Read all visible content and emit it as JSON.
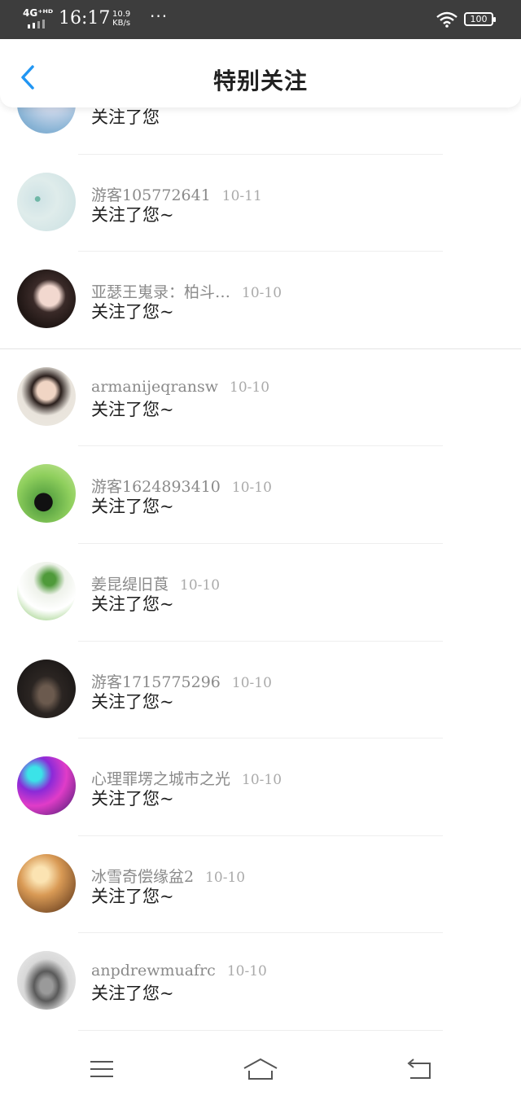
{
  "status_bar": {
    "network": "4G⁺ᴴᴰ",
    "time": "16:17",
    "speed_value": "10.9",
    "speed_unit": "KB/s",
    "more": "···",
    "battery": "100"
  },
  "header": {
    "title": "特别关注",
    "back_icon": "chevron-left-icon",
    "accent_color": "#2196F3"
  },
  "items": [
    {
      "name": "",
      "date": "",
      "message": "关注了您",
      "avatar": "girl-sky-photo"
    },
    {
      "name": "游客105772641",
      "date": "10-11",
      "message": "关注了您~",
      "avatar": "flower-sky-photo"
    },
    {
      "name": "亚瑟王嵬录：柏斗…",
      "date": "10-10",
      "message": "关注了您~",
      "avatar": "girl-portrait-photo"
    },
    {
      "name": "armanijeqransw",
      "date": "10-10",
      "message": "关注了您~",
      "avatar": "woman-portrait-photo"
    },
    {
      "name": "游客1624893410",
      "date": "10-10",
      "message": "关注了您~",
      "avatar": "kumamon-photo"
    },
    {
      "name": "姜昆缇旧莨",
      "date": "10-10",
      "message": "关注了您~",
      "avatar": "green-sprout-photo"
    },
    {
      "name": "游客1715775296",
      "date": "10-10",
      "message": "关注了您~",
      "avatar": "vintage-car-photo"
    },
    {
      "name": "心理罪塄之城市之光",
      "date": "10-10",
      "message": "关注了您~",
      "avatar": "bokeh-lights-photo"
    },
    {
      "name": "冰雪奇偿缘盆2",
      "date": "10-10",
      "message": "关注了您~",
      "avatar": "sunset-girl-photo"
    },
    {
      "name": "anpdrewmuafrc",
      "date": "10-10",
      "message": "关注了您~",
      "avatar": "classic-car-photo"
    }
  ],
  "nav_bar": {
    "menu_icon": "menu-icon",
    "home_icon": "home-icon",
    "back_icon": "back-arrow-icon"
  }
}
